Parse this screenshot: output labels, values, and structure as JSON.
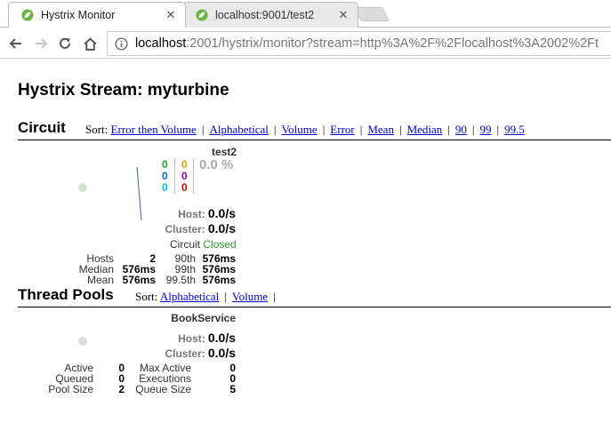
{
  "browser": {
    "tabs": [
      {
        "title": "Hystrix Monitor",
        "active": true
      },
      {
        "title": "localhost:9001/test2",
        "active": false
      }
    ],
    "url_host": "localhost",
    "url_rest": ":2001/hystrix/monitor?stream=http%3A%2F%2Flocalhost%3A2002%2Ft",
    "accent": "#6db33f"
  },
  "page": {
    "title": "Hystrix Stream: myturbine"
  },
  "circuit_section": {
    "title": "Circuit",
    "sort_label": "Sort:",
    "sort_options": [
      "Error then Volume",
      "Alphabetical",
      "Volume",
      "Error",
      "Mean",
      "Median",
      "90",
      "99",
      "99.5"
    ]
  },
  "circuit": {
    "name": "test2",
    "counts": {
      "success": "0",
      "short_circuited": "0",
      "bad_request": "0",
      "timeout": "0",
      "rejected": "0",
      "failure": "0"
    },
    "error_pct": "0.0 %",
    "host_label": "Host:",
    "host_rate": "0.0/s",
    "cluster_label": "Cluster:",
    "cluster_rate": "0.0/s",
    "circuit_label": "Circuit",
    "circuit_status": "Closed",
    "stats": {
      "hosts_label": "Hosts",
      "hosts": "2",
      "median_label": "Median",
      "median": "576ms",
      "mean_label": "Mean",
      "mean": "576ms",
      "p90_label": "90th",
      "p90": "576ms",
      "p99_label": "99th",
      "p99": "576ms",
      "p995_label": "99.5th",
      "p995": "576ms"
    }
  },
  "threadpool_section": {
    "title": "Thread Pools",
    "sort_label": "Sort:",
    "sort_options": [
      "Alphabetical",
      "Volume"
    ]
  },
  "threadpool": {
    "name": "BookService",
    "host_label": "Host:",
    "host_rate": "0.0/s",
    "cluster_label": "Cluster:",
    "cluster_rate": "0.0/s",
    "stats": {
      "active_label": "Active",
      "active": "0",
      "queued_label": "Queued",
      "queued": "0",
      "pool_size_label": "Pool Size",
      "pool_size": "2",
      "max_active_label": "Max Active",
      "max_active": "0",
      "executions_label": "Executions",
      "executions": "0",
      "queue_size_label": "Queue Size",
      "queue_size": "5"
    }
  },
  "colors": {
    "success": "#2a9a2a",
    "short_circuited": "#0066cc",
    "bad_request": "#00c0c0",
    "timeout": "#e0a000",
    "rejected": "#a000a0",
    "failure": "#dd0000",
    "link": "#0000cc"
  }
}
